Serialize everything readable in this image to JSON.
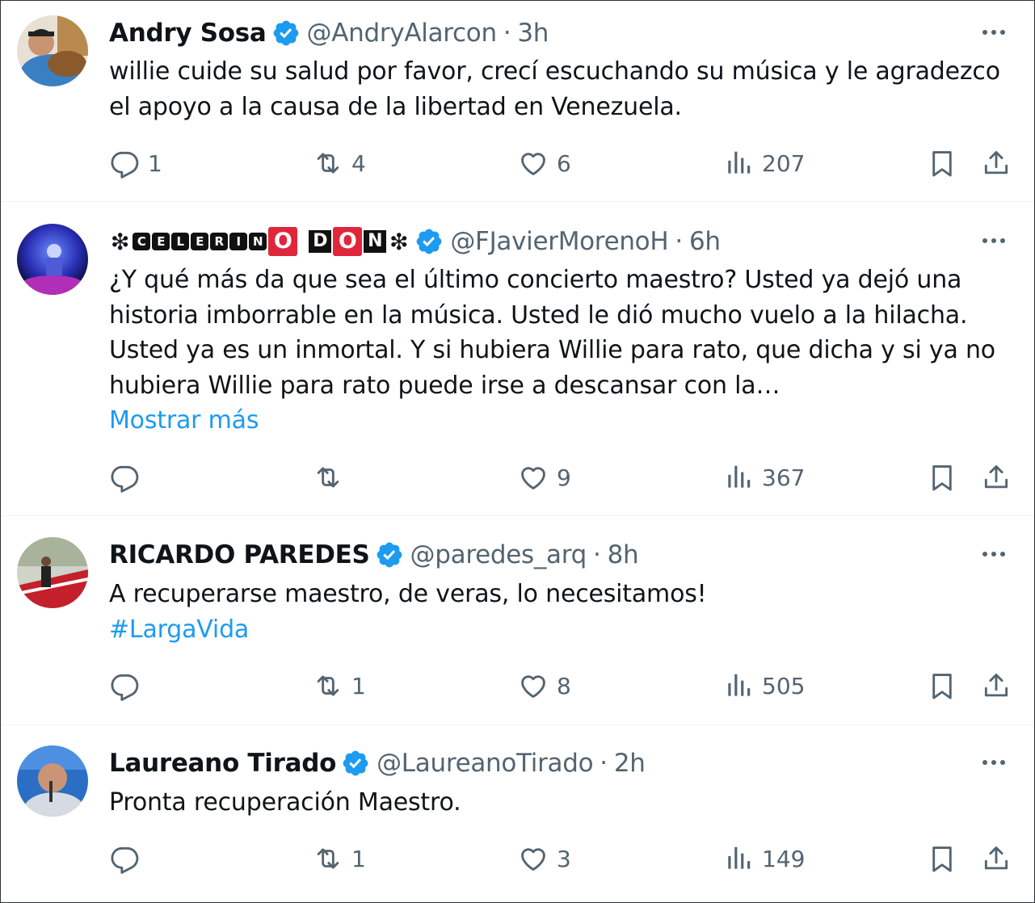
{
  "tweets": [
    {
      "name": "Andry Sosa",
      "handle": "@AndryAlarcon",
      "separator": "·",
      "time": "3h",
      "text_lines": [
        "willie cuide su salud por favor, crecí escuchando su música y le agradezco",
        "el apoyo a la causa de la libertad en Venezuela."
      ],
      "replies": "1",
      "retweets": "4",
      "likes": "6",
      "views": "207"
    },
    {
      "name": "❇CELERINO DON❇",
      "name_parts": {
        "lead_symbol": "❇",
        "letters": [
          "C",
          "E",
          "L",
          "E",
          "R",
          "I",
          "N"
        ],
        "red_o": "O",
        "letter_d": "D",
        "red_o2": "O",
        "letter_n": "N",
        "trail_symbol": "❇"
      },
      "handle": "@FJavierMorenoH",
      "separator": "·",
      "time": "6h",
      "text_lines": [
        "¿Y qué más da que sea el último concierto maestro? Usted ya dejó una",
        "historia imborrable en la música. Usted le dió mucho vuelo a la hilacha.",
        "Usted ya es un inmortal. Y si hubiera Willie para rato, que dicha y si ya no",
        "hubiera Willie para rato puede irse a descansar con la…"
      ],
      "show_more": "Mostrar más",
      "replies": "",
      "retweets": "",
      "likes": "9",
      "views": "367"
    },
    {
      "name": "RICARDO PAREDES",
      "handle": "@paredes_arq",
      "separator": "·",
      "time": "8h",
      "text_lines": [
        "A recuperarse maestro, de veras, lo necesitamos!"
      ],
      "hashtag": "#LargaVida",
      "replies": "",
      "retweets": "1",
      "likes": "8",
      "views": "505"
    },
    {
      "name": "Laureano Tirado",
      "handle": "@LaureanoTirado",
      "separator": "·",
      "time": "2h",
      "text_lines": [
        "Pronta recuperación Maestro."
      ],
      "replies": "",
      "retweets": "1",
      "likes": "3",
      "views": "149"
    }
  ],
  "icons": {
    "verified": "verified-badge-icon",
    "more": "more-options-icon",
    "reply": "reply-icon",
    "retweet": "retweet-icon",
    "like": "like-icon",
    "views": "views-icon",
    "bookmark": "bookmark-icon",
    "share": "share-icon"
  },
  "colors": {
    "accent": "#1d9bf0",
    "secondary_text": "#536471",
    "verified": "#1d9bf0"
  }
}
